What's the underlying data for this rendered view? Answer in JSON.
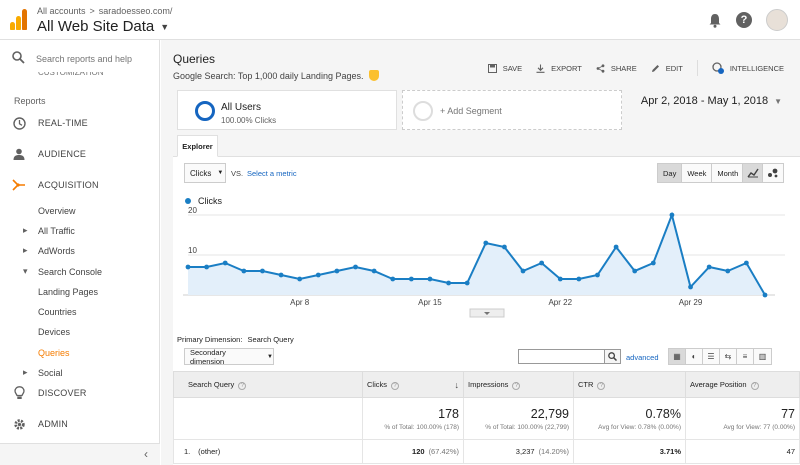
{
  "header": {
    "breadcrumb": [
      "All accounts",
      "saradoesseo.com/"
    ],
    "breadcrumb_sep": ">",
    "account_title": "All Web Site Data",
    "icons": [
      "bell-icon",
      "help-icon",
      "avatar"
    ]
  },
  "sidebar": {
    "search_placeholder": "Search reports and help",
    "cut_text": "CUSTOMIZATION",
    "section_label": "Reports",
    "nav": [
      {
        "label": "REAL-TIME",
        "icon": "clock-icon"
      },
      {
        "label": "AUDIENCE",
        "icon": "person-icon"
      },
      {
        "label": "ACQUISITION",
        "icon": "acquisition-icon"
      },
      {
        "label": "DISCOVER",
        "icon": "lightbulb-icon"
      },
      {
        "label": "ADMIN",
        "icon": "gear-icon"
      }
    ],
    "sub": [
      "Overview",
      "All Traffic",
      "AdWords",
      "Search Console",
      "Landing Pages",
      "Countries",
      "Devices",
      "Queries",
      "Social"
    ],
    "collapse_glyph": "‹",
    "accent": "#f57c00"
  },
  "main": {
    "title": "Queries",
    "subtitle": "Google Search: Top 1,000 daily Landing Pages.",
    "toolbar": [
      "SAVE",
      "EXPORT",
      "SHARE",
      "EDIT",
      "INTELLIGENCE"
    ],
    "segment": {
      "name": "All Users",
      "sub": "100.00% Clicks",
      "add": "+ Add Segment"
    },
    "date_range": "Apr 2, 2018 - May 1, 2018",
    "tab": "Explorer",
    "metric": "Clicks",
    "vs": "VS.",
    "select_metric": "Select a metric",
    "grain": [
      "Day",
      "Week",
      "Month"
    ],
    "grain_selected": "Day",
    "primary_dimension_label": "Primary Dimension:",
    "primary_dimension_value": "Search Query",
    "secondary_dimension": "Secondary dimension",
    "advanced": "advanced"
  },
  "chart_data": {
    "type": "area",
    "series": [
      {
        "name": "Clicks",
        "color": "#1a7ec4",
        "values": [
          7,
          7,
          8,
          6,
          6,
          5,
          4,
          5,
          6,
          7,
          6,
          4,
          4,
          4,
          3,
          3,
          13,
          12,
          6,
          8,
          4,
          4,
          5,
          12,
          6,
          8,
          20,
          2,
          7,
          6,
          8,
          0
        ]
      }
    ],
    "x_tick_labels": [
      "Apr 8",
      "Apr 15",
      "Apr 22",
      "Apr 29"
    ],
    "x_tick_index": [
      6,
      13,
      20,
      27
    ],
    "y_ticks": [
      10,
      20
    ],
    "ylim": [
      0,
      20
    ],
    "grid": true
  },
  "table": {
    "columns": [
      "Search Query",
      "Clicks",
      "Impressions",
      "CTR",
      "Average Position"
    ],
    "totals": [
      {
        "value": "178",
        "sub": "% of Total: 100.00% (178)"
      },
      {
        "value": "22,799",
        "sub": "% of Total: 100.00% (22,799)"
      },
      {
        "value": "0.78%",
        "sub": "Avg for View: 0.78% (0.00%)"
      },
      {
        "value": "77",
        "sub": "Avg for View: 77 (0.00%)"
      }
    ],
    "rows": [
      {
        "n": "1.",
        "query": "(other)",
        "clicks": "120",
        "clicks_pct": "(67.42%)",
        "impr": "3,237",
        "impr_pct": "(14.20%)",
        "ctr": "3.71%",
        "pos": "47"
      }
    ]
  }
}
